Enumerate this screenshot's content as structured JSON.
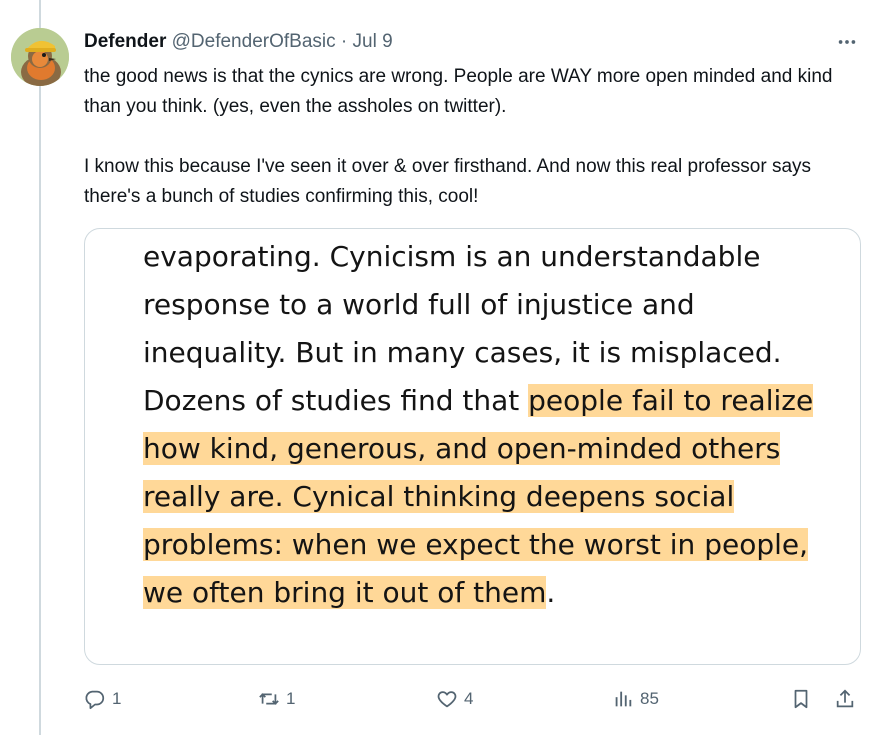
{
  "author": {
    "name": "Defender",
    "handle": "@DefenderOfBasic",
    "separator": "·",
    "date": "Jul 9"
  },
  "tweet": {
    "paragraph_1": "the good news is that the cynics are wrong. People are WAY more open minded and kind than you think. (yes, even the assholes on twitter).",
    "paragraph_2": "I know this because I've seen it over & over firsthand. And now this real professor says there's a bunch of studies confirming this, cool!"
  },
  "media": {
    "plain_text": "evaporating. Cynicism is an understandable response to a world full of injustice and inequality. But in many cases, it is misplaced. Dozens of studies find that ",
    "highlighted_text": "people fail to realize how kind, generous, and open-minded others really are. Cynical thinking deepens social problems: when we expect the worst in people, we often bring it out of them",
    "trailing_text": ".",
    "highlight_color": "#ffd898"
  },
  "actions": {
    "reply_count": "1",
    "repost_count": "1",
    "like_count": "4",
    "views_count": "85"
  },
  "icons": {
    "more": "more-icon",
    "reply": "reply-icon",
    "repost": "repost-icon",
    "like": "heart-icon",
    "views": "views-icon",
    "bookmark": "bookmark-icon",
    "share": "share-icon"
  },
  "colors": {
    "text": "#0f1419",
    "secondary": "#536471",
    "border": "#cfd9de"
  }
}
